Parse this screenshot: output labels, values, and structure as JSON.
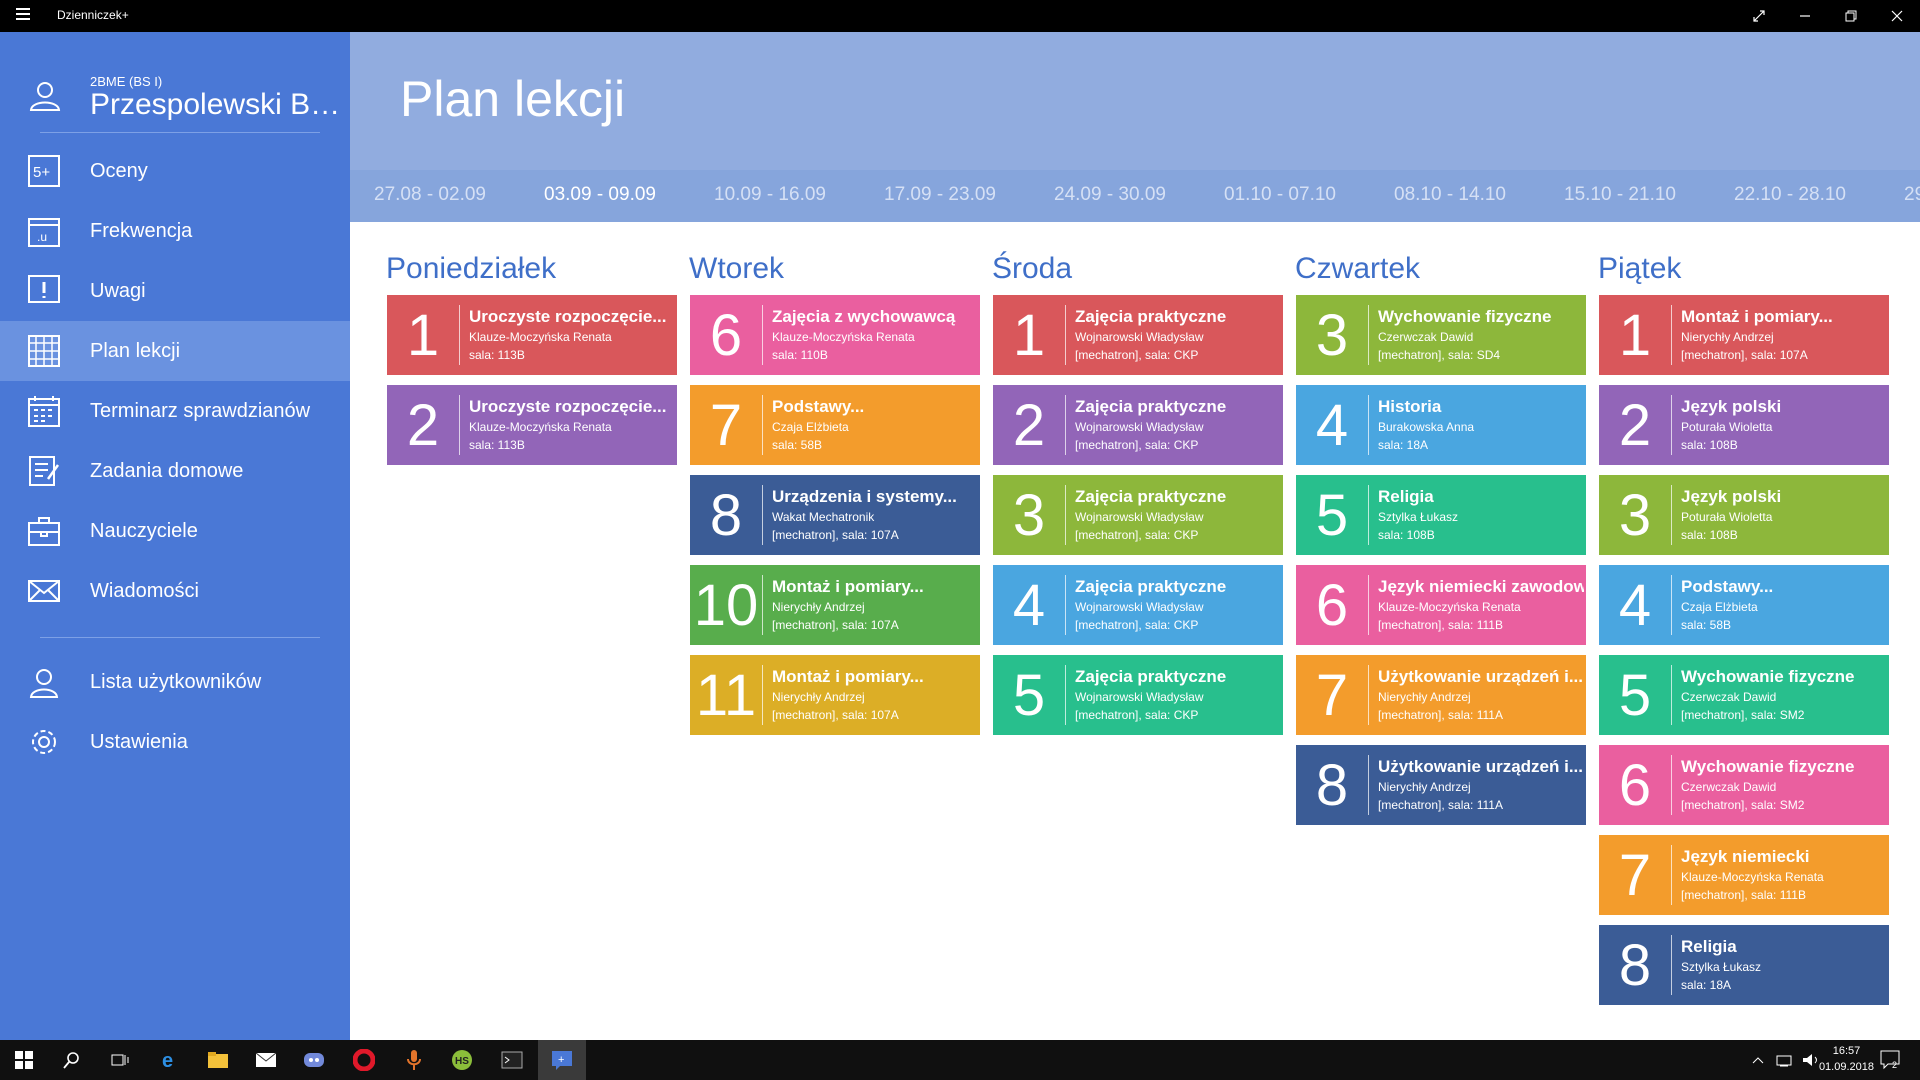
{
  "window": {
    "title": "Dzienniczek+"
  },
  "user": {
    "class": "2BME (BS I)",
    "name": "Przespolewski Bar..."
  },
  "nav": [
    {
      "label": "Oceny",
      "icon": "grades-icon"
    },
    {
      "label": "Frekwencja",
      "icon": "attendance-icon"
    },
    {
      "label": "Uwagi",
      "icon": "notes-icon"
    },
    {
      "label": "Plan lekcji",
      "icon": "timetable-icon"
    },
    {
      "label": "Terminarz sprawdzianów",
      "icon": "calendar-icon"
    },
    {
      "label": "Zadania domowe",
      "icon": "homework-icon"
    },
    {
      "label": "Nauczyciele",
      "icon": "teachers-icon"
    },
    {
      "label": "Wiadomości",
      "icon": "mail-icon"
    }
  ],
  "nav_bottom": [
    {
      "label": "Lista użytkowników",
      "icon": "user-icon"
    },
    {
      "label": "Ustawienia",
      "icon": "gear-icon"
    }
  ],
  "page_title": "Plan lekcji",
  "weeks": [
    "27.08 - 02.09",
    "03.09 - 09.09",
    "10.09 - 16.09",
    "17.09 - 23.09",
    "24.09 - 30.09",
    "01.10 - 07.10",
    "08.10 - 14.10",
    "15.10 - 21.10",
    "22.10 - 28.10",
    "29"
  ],
  "selected_week": "03.09 - 09.09",
  "days": [
    {
      "name": "Poniedziałek",
      "lessons": [
        {
          "num": "1",
          "subject": "Uroczyste rozpoczęcie...",
          "teacher": "Klauze-Moczyńska Renata",
          "room": "sala: 113B",
          "color": "#d9575b"
        },
        {
          "num": "2",
          "subject": "Uroczyste rozpoczęcie...",
          "teacher": "Klauze-Moczyńska Renata",
          "room": "sala: 113B",
          "color": "#9265b8"
        }
      ]
    },
    {
      "name": "Wtorek",
      "lessons": [
        {
          "num": "6",
          "subject": "Zajęcia z wychowawcą",
          "teacher": "Klauze-Moczyńska Renata",
          "room": "sala: 110B",
          "color": "#ea5f9f"
        },
        {
          "num": "7",
          "subject": "Podstawy...",
          "teacher": "Czaja Elżbieta",
          "room": "sala: 58B",
          "color": "#f39c2c"
        },
        {
          "num": "8",
          "subject": "Urządzenia i systemy...",
          "teacher": "Wakat Mechatronik",
          "room": "[mechatron], sala: 107A",
          "color": "#3b5c96"
        },
        {
          "num": "10",
          "subject": "Montaż i pomiary...",
          "teacher": "Nierychły Andrzej",
          "room": "[mechatron], sala: 107A",
          "color": "#58ad4c"
        },
        {
          "num": "11",
          "subject": "Montaż i pomiary...",
          "teacher": "Nierychły Andrzej",
          "room": "[mechatron], sala: 107A",
          "color": "#dcae26"
        }
      ]
    },
    {
      "name": "Środa",
      "lessons": [
        {
          "num": "1",
          "subject": "Zajęcia praktyczne",
          "teacher": "Wojnarowski Władysław",
          "room": "[mechatron], sala: CKP",
          "color": "#d9575b"
        },
        {
          "num": "2",
          "subject": "Zajęcia praktyczne",
          "teacher": "Wojnarowski Władysław",
          "room": "[mechatron], sala: CKP",
          "color": "#9265b8"
        },
        {
          "num": "3",
          "subject": "Zajęcia praktyczne",
          "teacher": "Wojnarowski Władysław",
          "room": "[mechatron], sala: CKP",
          "color": "#8db73b"
        },
        {
          "num": "4",
          "subject": "Zajęcia praktyczne",
          "teacher": "Wojnarowski Władysław",
          "room": "[mechatron], sala: CKP",
          "color": "#4aa6e0"
        },
        {
          "num": "5",
          "subject": "Zajęcia praktyczne",
          "teacher": "Wojnarowski Władysław",
          "room": "[mechatron], sala: CKP",
          "color": "#28bf8d"
        }
      ]
    },
    {
      "name": "Czwartek",
      "lessons": [
        {
          "num": "3",
          "subject": "Wychowanie fizyczne",
          "teacher": "Czerwczak Dawid",
          "room": "[mechatron], sala: SD4",
          "color": "#8db73b"
        },
        {
          "num": "4",
          "subject": "Historia",
          "teacher": "Burakowska Anna",
          "room": "sala: 18A",
          "color": "#4aa6e0"
        },
        {
          "num": "5",
          "subject": "Religia",
          "teacher": "Sztylka Łukasz",
          "room": "sala: 108B",
          "color": "#28bf8d"
        },
        {
          "num": "6",
          "subject": "Język niemiecki zawodowy",
          "teacher": "Klauze-Moczyńska Renata",
          "room": "[mechatron], sala: 111B",
          "color": "#ea5f9f"
        },
        {
          "num": "7",
          "subject": "Użytkowanie urządzeń i...",
          "teacher": "Nierychły Andrzej",
          "room": "[mechatron], sala: 111A",
          "color": "#f39c2c"
        },
        {
          "num": "8",
          "subject": "Użytkowanie urządzeń i...",
          "teacher": "Nierychły Andrzej",
          "room": "[mechatron], sala: 111A",
          "color": "#3b5c96"
        }
      ]
    },
    {
      "name": "Piątek",
      "lessons": [
        {
          "num": "1",
          "subject": "Montaż i pomiary...",
          "teacher": "Nierychły Andrzej",
          "room": "[mechatron], sala: 107A",
          "color": "#d9575b"
        },
        {
          "num": "2",
          "subject": "Język polski",
          "teacher": "Poturała Wioletta",
          "room": "sala: 108B",
          "color": "#9265b8"
        },
        {
          "num": "3",
          "subject": "Język polski",
          "teacher": "Poturała Wioletta",
          "room": "sala: 108B",
          "color": "#8db73b"
        },
        {
          "num": "4",
          "subject": "Podstawy...",
          "teacher": "Czaja Elżbieta",
          "room": "sala: 58B",
          "color": "#4aa6e0"
        },
        {
          "num": "5",
          "subject": "Wychowanie fizyczne",
          "teacher": "Czerwczak Dawid",
          "room": "[mechatron], sala: SM2",
          "color": "#28bf8d"
        },
        {
          "num": "6",
          "subject": "Wychowanie fizyczne",
          "teacher": "Czerwczak Dawid",
          "room": "[mechatron], sala: SM2",
          "color": "#ea5f9f"
        },
        {
          "num": "7",
          "subject": "Język niemiecki",
          "teacher": "Klauze-Moczyńska Renata",
          "room": "[mechatron], sala: 111B",
          "color": "#f39c2c"
        },
        {
          "num": "8",
          "subject": "Religia",
          "teacher": "Sztylka Łukasz",
          "room": "sala: 18A",
          "color": "#3b5c96"
        }
      ]
    }
  ],
  "taskbar": {
    "time": "16:57",
    "date": "01.09.2018",
    "notifications": "2"
  }
}
